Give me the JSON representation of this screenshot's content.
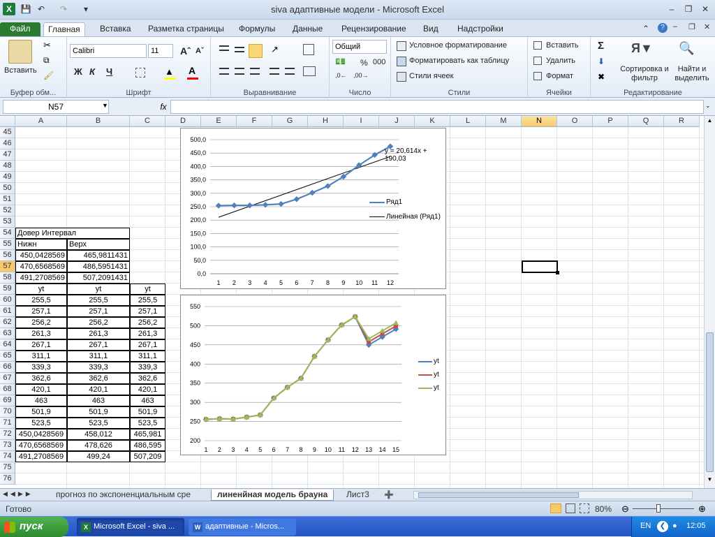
{
  "window": {
    "title": "siva адаптивные модели  -  Microsoft Excel"
  },
  "ribbon_tabs": [
    "Файл",
    "Главная",
    "Вставка",
    "Разметка страницы",
    "Формулы",
    "Данные",
    "Рецензирование",
    "Вид",
    "Надстройки"
  ],
  "ribbon": {
    "clipboard": {
      "label": "Буфер обм...",
      "paste": "Вставить"
    },
    "font": {
      "label": "Шрифт",
      "name": "Calibri",
      "size": "11",
      "bold": "Ж",
      "italic": "К",
      "underline": "Ч"
    },
    "alignment": {
      "label": "Выравнивание"
    },
    "number": {
      "label": "Число",
      "format": "Общий",
      "percent": "%",
      "thousands": "000"
    },
    "styles": {
      "label": "Стили",
      "cond": "Условное форматирование",
      "table": "Форматировать как таблицу",
      "cell_styles": "Стили ячеек"
    },
    "cells": {
      "label": "Ячейки",
      "insert": "Вставить",
      "delete": "Удалить",
      "format": "Формат"
    },
    "editing": {
      "label": "Редактирование",
      "sort": "Сортировка и фильтр",
      "find": "Найти и выделить",
      "sigma": "Σ"
    }
  },
  "formula_bar": {
    "name_box": "N57",
    "fx": "fx",
    "value": ""
  },
  "columns": [
    "A",
    "B",
    "C",
    "D",
    "E",
    "F",
    "G",
    "H",
    "I",
    "J",
    "K",
    "L",
    "M",
    "N",
    "O",
    "P",
    "Q",
    "R"
  ],
  "selected_column": "N",
  "rows": [
    "45",
    "46",
    "47",
    "48",
    "49",
    "50",
    "51",
    "52",
    "53",
    "54",
    "55",
    "56",
    "57",
    "58",
    "59",
    "60",
    "61",
    "62",
    "63",
    "64",
    "65",
    "66",
    "67",
    "68",
    "69",
    "70",
    "71",
    "72",
    "73",
    "74",
    "75",
    "76"
  ],
  "selected_row": "57",
  "cells": {
    "r54": {
      "a": "Довер Интервал"
    },
    "r55": {
      "a": "Нижн",
      "b": "Верх"
    },
    "r56": {
      "a": "450,0428569",
      "b": "465,9811431"
    },
    "r57": {
      "a": "470,6568569",
      "b": "486,5951431"
    },
    "r58": {
      "a": "491,2708569",
      "b": "507,2091431"
    },
    "table": [
      [
        "yt",
        "yt",
        "yt"
      ],
      [
        "255,5",
        "255,5",
        "255,5"
      ],
      [
        "257,1",
        "257,1",
        "257,1"
      ],
      [
        "256,2",
        "256,2",
        "256,2"
      ],
      [
        "261,3",
        "261,3",
        "261,3"
      ],
      [
        "267,1",
        "267,1",
        "267,1"
      ],
      [
        "311,1",
        "311,1",
        "311,1"
      ],
      [
        "339,3",
        "339,3",
        "339,3"
      ],
      [
        "362,6",
        "362,6",
        "362,6"
      ],
      [
        "420,1",
        "420,1",
        "420,1"
      ],
      [
        "463",
        "463",
        "463"
      ],
      [
        "501,9",
        "501,9",
        "501,9"
      ],
      [
        "523,5",
        "523,5",
        "523,5"
      ],
      [
        "450,0428569",
        "458,012",
        "465,981"
      ],
      [
        "470,6568569",
        "478,626",
        "486,595"
      ],
      [
        "491,2708569",
        "499,24",
        "507,209"
      ]
    ]
  },
  "chart1": {
    "equation": "y = 20,614x + 190,03",
    "legend": [
      "Ряд1",
      "Линейная (Ряд1)"
    ],
    "yticks": [
      "500,0",
      "450,0",
      "400,0",
      "350,0",
      "300,0",
      "250,0",
      "200,0",
      "150,0",
      "100,0",
      "50,0",
      "0,0"
    ],
    "xticks": [
      "1",
      "2",
      "3",
      "4",
      "5",
      "6",
      "7",
      "8",
      "9",
      "10",
      "11",
      "12"
    ],
    "color": "#4f81bd"
  },
  "chart2": {
    "yticks": [
      "550",
      "500",
      "450",
      "400",
      "350",
      "300",
      "250",
      "200"
    ],
    "xticks": [
      "1",
      "2",
      "3",
      "4",
      "5",
      "6",
      "7",
      "8",
      "9",
      "10",
      "11",
      "12",
      "13",
      "14",
      "15"
    ],
    "legend": [
      "yt",
      "yt",
      "yt"
    ],
    "colors": [
      "#4f81bd",
      "#c0504d",
      "#9bbb59"
    ]
  },
  "sheet_tabs": {
    "tab1": "прогноз по экспоненциальным сре",
    "tab2": "линенйная модель брауна",
    "tab3": "Лист3"
  },
  "status": {
    "ready": "Готово",
    "zoom": "80%"
  },
  "taskbar": {
    "start": "пуск",
    "task1": "Microsoft Excel - siva ...",
    "task2": "адаптивные - Micros...",
    "lang": "EN",
    "time": "12:05"
  }
}
